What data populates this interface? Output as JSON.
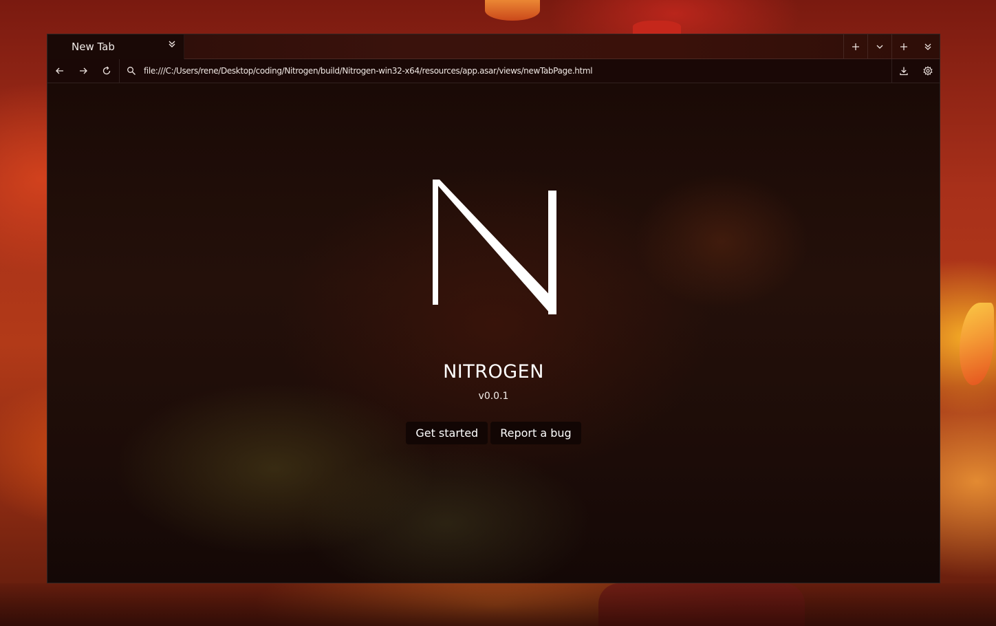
{
  "tab": {
    "title": "New Tab",
    "menu_icon": "chevron-double-down-icon"
  },
  "tabbar_controls": [
    {
      "icon": "plus-icon"
    },
    {
      "icon": "chevron-down-icon"
    },
    {
      "icon": "plus-icon"
    },
    {
      "icon": "chevron-double-down-icon"
    }
  ],
  "navbar": {
    "back_icon": "arrow-left-icon",
    "forward_icon": "arrow-right-icon",
    "reload_icon": "reload-icon",
    "search_icon": "search-icon",
    "address": "file:///C:/Users/rene/Desktop/coding/Nitrogen/build/Nitrogen-win32-x64/resources/app.asar/views/newTabPage.html",
    "download_icon": "download-icon",
    "settings_icon": "gear-icon"
  },
  "page": {
    "logo_icon": "nitrogen-n-logo",
    "brand": "NITROGEN",
    "version": "v0.0.1",
    "buttons": {
      "get_started": "Get started",
      "report_bug": "Report a bug"
    }
  },
  "colors": {
    "window_bg": "#140806",
    "tabbar_bg": "#3a120c",
    "button_bg": "#120604",
    "text": "#ffffff"
  }
}
